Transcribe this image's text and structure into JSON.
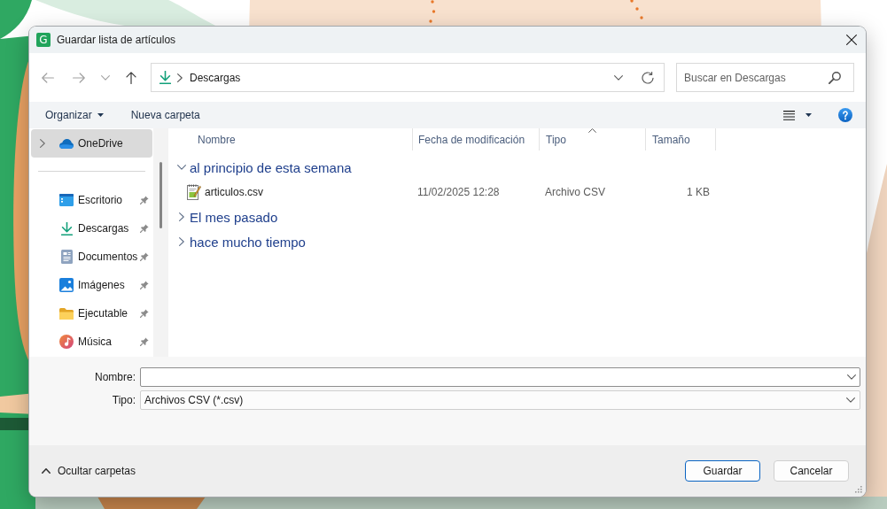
{
  "window": {
    "title": "Guardar lista de artículos",
    "app_logo": "G"
  },
  "navigation": {
    "back": {
      "disabled": true
    },
    "forward": {
      "disabled": true
    },
    "up": {
      "disabled": false
    },
    "address": {
      "segments": [
        {
          "label": "Descargas"
        }
      ]
    },
    "search": {
      "placeholder": "Buscar en Descargas"
    }
  },
  "command_bar": {
    "items": [
      {
        "label": "Organizar",
        "kind": "menu"
      },
      {
        "label": "Nueva carpeta",
        "kind": "button"
      }
    ]
  },
  "sidebar": {
    "root": {
      "label": "OneDrive",
      "selected": true,
      "expanded": false
    },
    "quick_access": [
      {
        "label": "Escritorio",
        "selected": false,
        "pinned": true
      },
      {
        "label": "Descargas",
        "selected": false,
        "pinned": true
      },
      {
        "label": "Documentos",
        "selected": false,
        "pinned": true
      },
      {
        "label": "Imágenes",
        "selected": false,
        "pinned": true
      },
      {
        "label": "Ejecutable",
        "selected": false,
        "pinned": true
      },
      {
        "label": "Música",
        "selected": false,
        "pinned": true
      }
    ]
  },
  "file_list": {
    "columns": [
      {
        "label": "Nombre",
        "sorted": false
      },
      {
        "label": "Fecha de modificación",
        "sorted": false
      },
      {
        "label": "Tipo",
        "sorted": true
      },
      {
        "label": "Tamaño",
        "sorted": false
      }
    ],
    "groups": [
      {
        "label": "al principio de esta semana",
        "expanded": true,
        "files": [
          {
            "name": "articulos.csv",
            "modified": "11/02/2025 12:28",
            "type": "Archivo CSV",
            "size": "1 KB"
          }
        ]
      },
      {
        "label": "El mes pasado",
        "expanded": false
      },
      {
        "label": "hace mucho tiempo",
        "expanded": false
      }
    ]
  },
  "form": {
    "fields": [
      {
        "label": "Nombre:",
        "kind": "combo"
      },
      {
        "label": "Tipo:",
        "kind": "select",
        "value": "Archivos CSV (*.csv)"
      }
    ]
  },
  "footer": {
    "toggle": {
      "label": "Ocultar carpetas"
    },
    "buttons": [
      {
        "label": "Guardar",
        "default": true
      },
      {
        "label": "Cancelar",
        "default": false
      }
    ]
  }
}
